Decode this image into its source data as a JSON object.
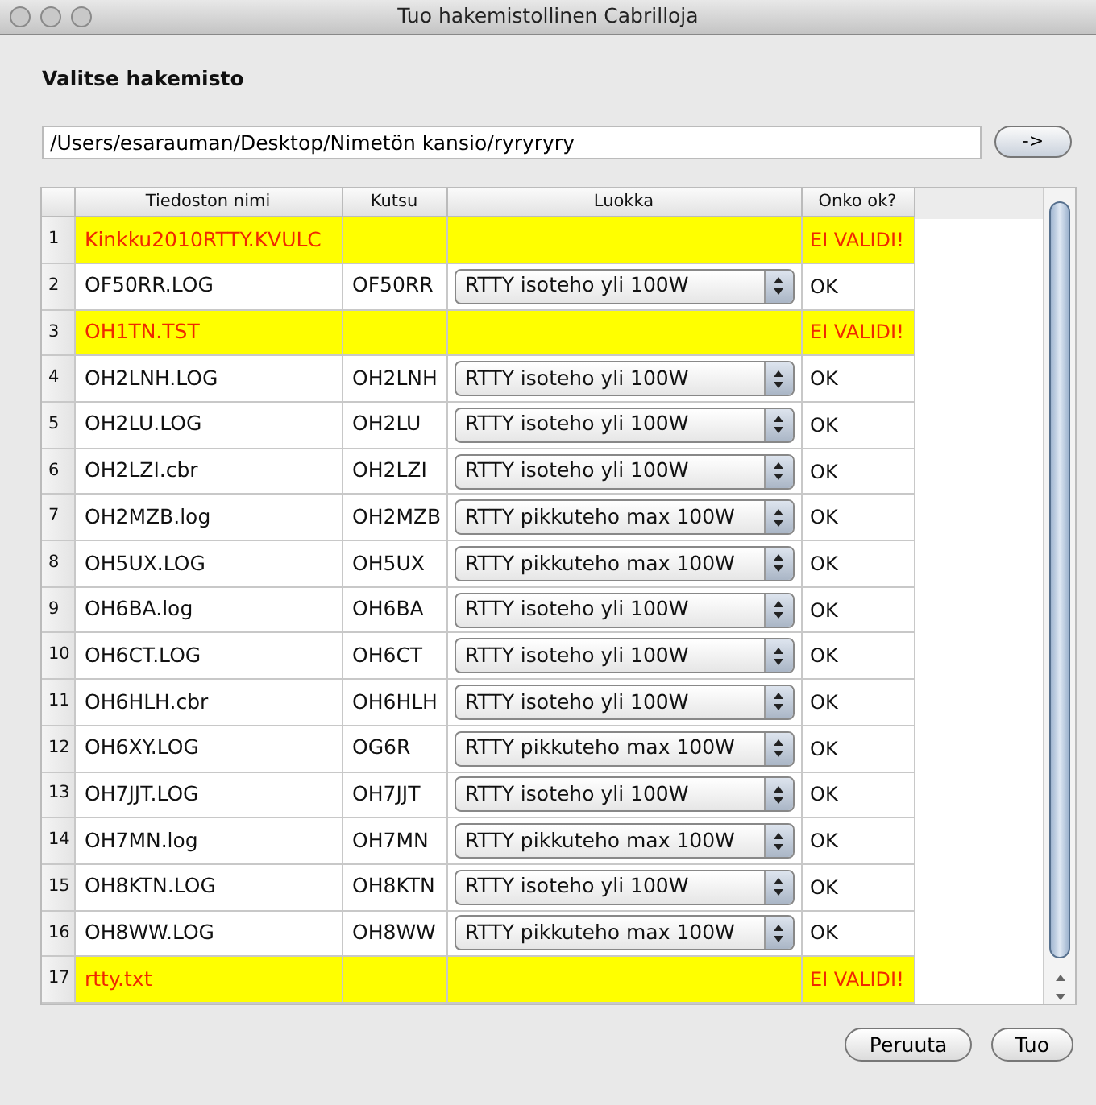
{
  "window": {
    "title": "Tuo hakemistollinen Cabrilloja"
  },
  "directory": {
    "label": "Valitse hakemisto",
    "value": "/Users/esarauman/Desktop/Nimetön kansio/ryryryry",
    "go_button": "->"
  },
  "table": {
    "columns": [
      "Tiedoston nimi",
      "Kutsu",
      "Luokka",
      "Onko ok?"
    ],
    "rows": [
      {
        "number": "1",
        "file": "Kinkku2010RTTY.KVULC",
        "valid": false,
        "status": "EI VALIDI!"
      },
      {
        "number": "2",
        "file": "OF50RR.LOG",
        "call": "OF50RR",
        "category": "RTTY isoteho yli 100W",
        "valid": true,
        "status": "OK"
      },
      {
        "number": "3",
        "file": "OH1TN.TST",
        "valid": false,
        "status": "EI VALIDI!"
      },
      {
        "number": "4",
        "file": "OH2LNH.LOG",
        "call": "OH2LNH",
        "category": "RTTY isoteho yli 100W",
        "valid": true,
        "status": "OK"
      },
      {
        "number": "5",
        "file": "OH2LU.LOG",
        "call": "OH2LU",
        "category": "RTTY isoteho yli 100W",
        "valid": true,
        "status": "OK"
      },
      {
        "number": "6",
        "file": "OH2LZI.cbr",
        "call": "OH2LZI",
        "category": "RTTY isoteho yli 100W",
        "valid": true,
        "status": "OK"
      },
      {
        "number": "7",
        "file": "OH2MZB.log",
        "call": "OH2MZB",
        "category": "RTTY pikkuteho max 100W",
        "valid": true,
        "status": "OK"
      },
      {
        "number": "8",
        "file": "OH5UX.LOG",
        "call": "OH5UX",
        "category": "RTTY pikkuteho max 100W",
        "valid": true,
        "status": "OK"
      },
      {
        "number": "9",
        "file": "OH6BA.log",
        "call": "OH6BA",
        "category": "RTTY isoteho yli 100W",
        "valid": true,
        "status": "OK"
      },
      {
        "number": "10",
        "file": "OH6CT.LOG",
        "call": "OH6CT",
        "category": "RTTY isoteho yli 100W",
        "valid": true,
        "status": "OK"
      },
      {
        "number": "11",
        "file": "OH6HLH.cbr",
        "call": "OH6HLH",
        "category": "RTTY isoteho yli 100W",
        "valid": true,
        "status": "OK"
      },
      {
        "number": "12",
        "file": "OH6XY.LOG",
        "call": "OG6R",
        "category": "RTTY pikkuteho max 100W",
        "valid": true,
        "status": "OK"
      },
      {
        "number": "13",
        "file": "OH7JJT.LOG",
        "call": "OH7JJT",
        "category": "RTTY isoteho yli 100W",
        "valid": true,
        "status": "OK"
      },
      {
        "number": "14",
        "file": "OH7MN.log",
        "call": "OH7MN",
        "category": "RTTY pikkuteho max 100W",
        "valid": true,
        "status": "OK"
      },
      {
        "number": "15",
        "file": "OH8KTN.LOG",
        "call": "OH8KTN",
        "category": "RTTY isoteho yli 100W",
        "valid": true,
        "status": "OK"
      },
      {
        "number": "16",
        "file": "OH8WW.LOG",
        "call": "OH8WW",
        "category": "RTTY pikkuteho max 100W",
        "valid": true,
        "status": "OK"
      },
      {
        "number": "17",
        "file": "rtty.txt",
        "valid": false,
        "status": "EI VALIDI!"
      }
    ]
  },
  "buttons": [
    "Peruuta",
    "Tuo"
  ]
}
